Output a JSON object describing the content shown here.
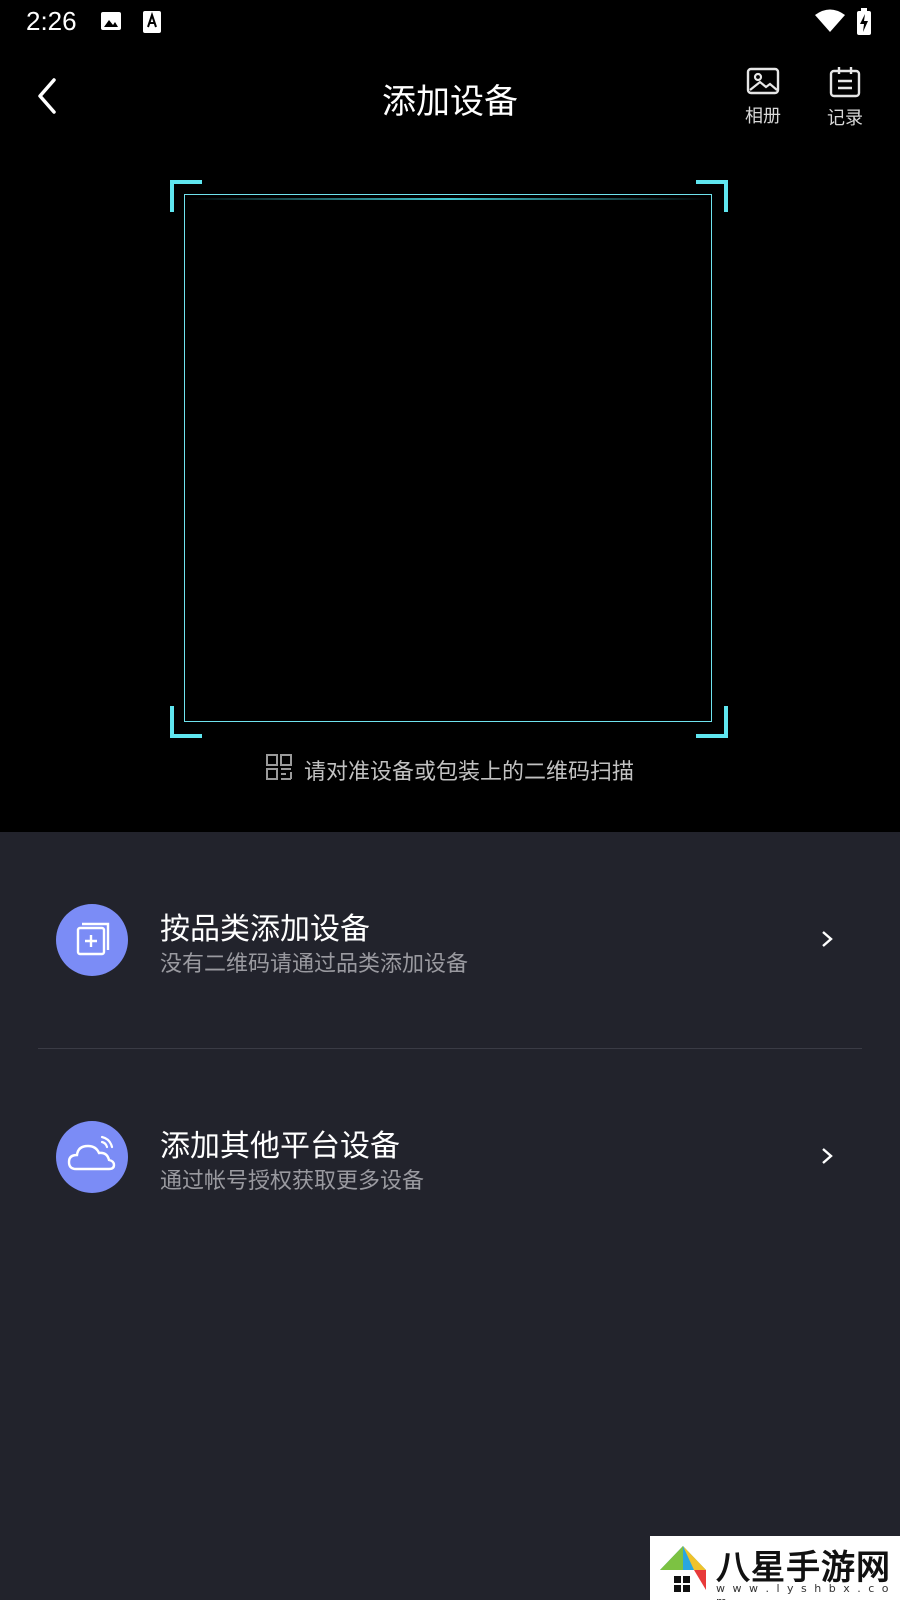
{
  "status_bar": {
    "time": "2:26"
  },
  "header": {
    "title": "添加设备",
    "album_label": "相册",
    "records_label": "记录"
  },
  "scanner": {
    "hint": "请对准设备或包装上的二维码扫描",
    "frame_color": "#5fe6f0"
  },
  "options": [
    {
      "title": "按品类添加设备",
      "subtitle": "没有二维码请通过品类添加设备",
      "icon": "add-copy-icon"
    },
    {
      "title": "添加其他平台设备",
      "subtitle": "通过帐号授权获取更多设备",
      "icon": "cloud-icon"
    }
  ],
  "colors": {
    "panel_bg": "#22232c",
    "icon_circle": "#7b8cf6"
  },
  "watermark": {
    "title": "八星手游网",
    "url": "w w w . l y s h b x . c o m"
  }
}
